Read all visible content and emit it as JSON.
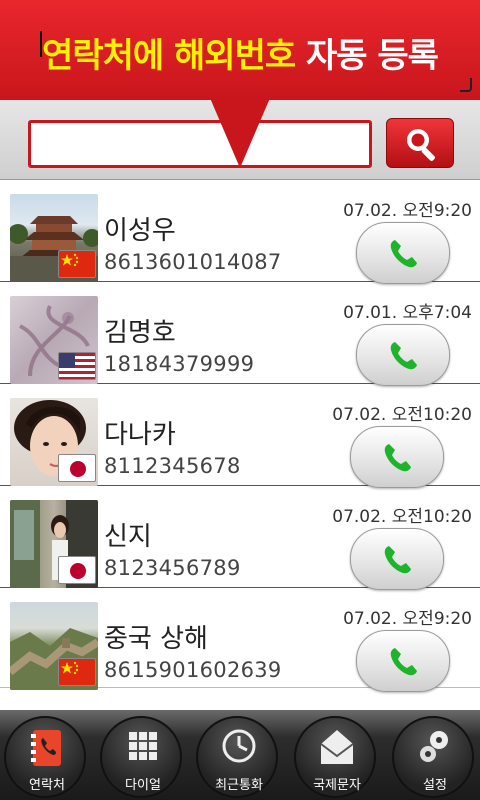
{
  "banner": {
    "text_yellow": "연락처에 해외번호 ",
    "text_white": "자동 등록"
  },
  "search": {
    "value": "",
    "placeholder": "",
    "button_icon": "search-icon"
  },
  "contacts": [
    {
      "name": "이성우",
      "phone": "8613601014087",
      "date": "07.02. 오전9:20",
      "flag": "china-flag",
      "photo": "pagoda-photo"
    },
    {
      "name": "김명호",
      "phone": "18184379999",
      "date": "07.01. 오후7:04",
      "flag": "usa-flag",
      "photo": "pattern-photo"
    },
    {
      "name": "다나카",
      "phone": "8112345678",
      "date": "07.02. 오전10:20",
      "flag": "japan-flag",
      "photo": "woman-photo"
    },
    {
      "name": "신지",
      "phone": "8123456789",
      "date": "07.02. 오전10:20",
      "flag": "japan-flag",
      "photo": "street-photo"
    },
    {
      "name": "중국 상해",
      "phone": "8615901602639",
      "date": "07.02. 오전9:20",
      "flag": "china-flag",
      "photo": "greatwall-photo"
    }
  ],
  "tabs": [
    {
      "label": "연락처",
      "icon": "contacts-icon",
      "active": true
    },
    {
      "label": "다이얼",
      "icon": "dialpad-icon",
      "active": false
    },
    {
      "label": "최근통화",
      "icon": "clock-icon",
      "active": false
    },
    {
      "label": "국제문자",
      "icon": "envelope-icon",
      "active": false
    },
    {
      "label": "설정",
      "icon": "gear-icon",
      "active": false
    }
  ],
  "colors": {
    "accent_red": "#c8161c",
    "banner_yellow": "#fff200",
    "call_green": "#1db32a"
  }
}
